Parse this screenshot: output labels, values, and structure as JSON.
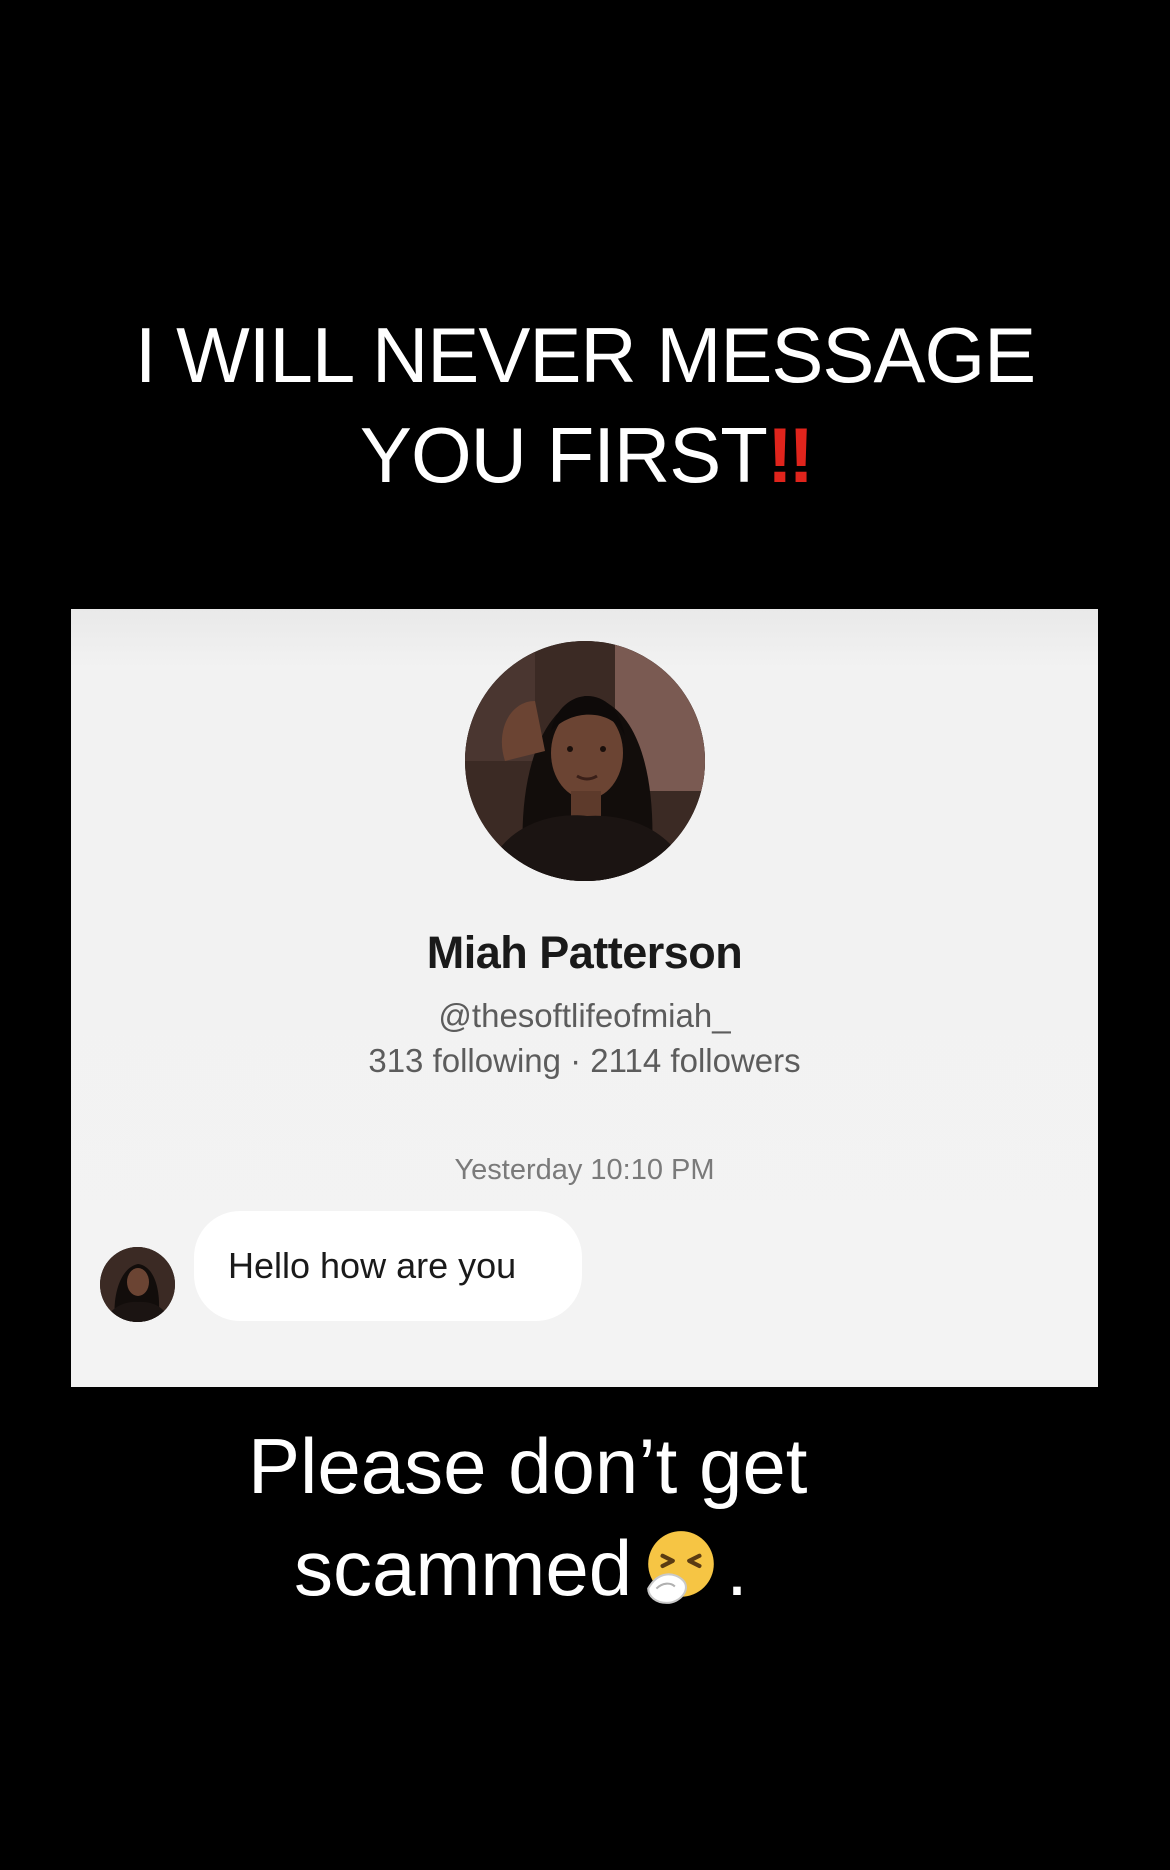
{
  "overlay": {
    "headline_line1": "I WILL NEVER MESSAGE",
    "headline_line2": "YOU FIRST",
    "headline_mark": "‼",
    "caption_line1": "Please don’t get",
    "caption_line2": "scammed",
    "caption_end": ".",
    "caption_emoji": "sneezing-face-icon"
  },
  "profile": {
    "name": "Miah Patterson",
    "handle": "@thesoftlifeofmiah_",
    "stats": "313 following · 2114 followers"
  },
  "chat": {
    "timestamp": "Yesterday 10:10 PM",
    "message": "Hello how are you"
  },
  "colors": {
    "background": "#000000",
    "overlay_text": "#ffffff",
    "exclamation": "#e0241c",
    "card_background": "#f3f3f3",
    "bubble": "#ffffff"
  }
}
